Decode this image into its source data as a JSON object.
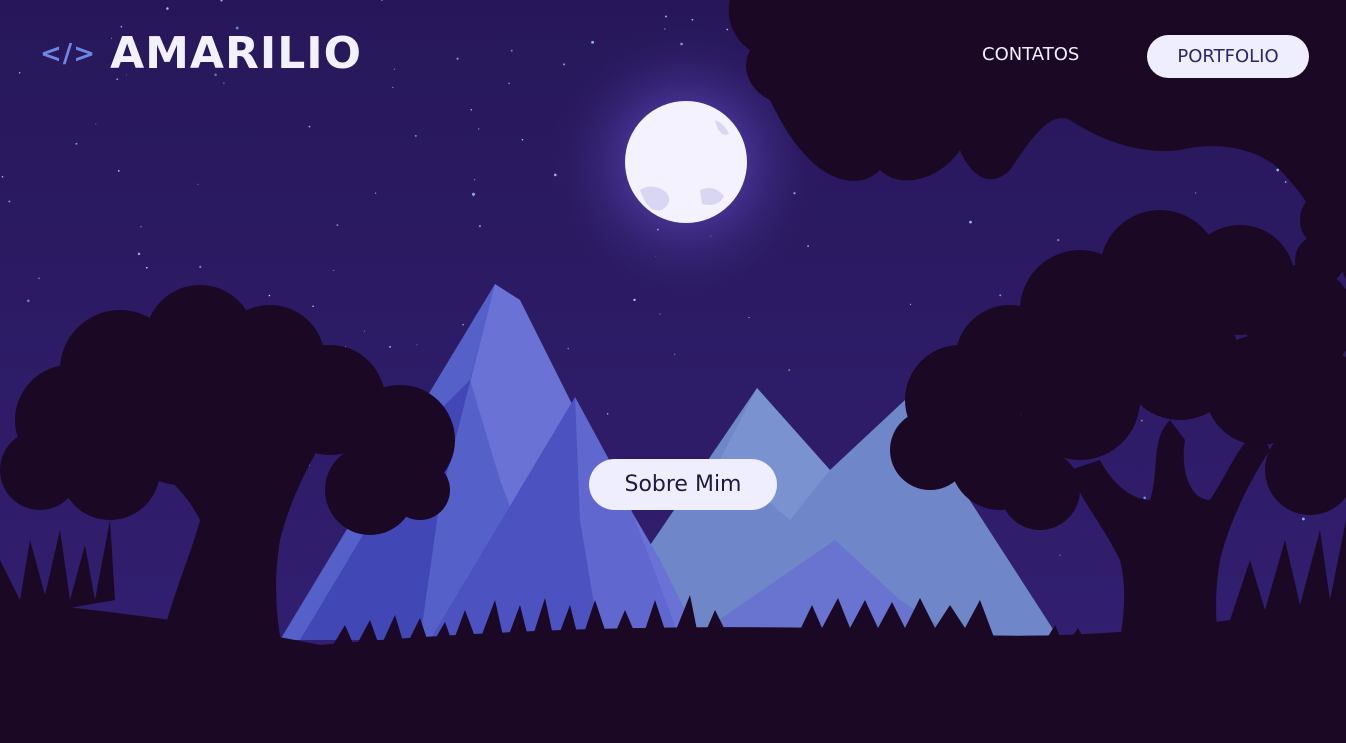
{
  "header": {
    "logo_icon": "</>",
    "logo_text": "AMARILIO",
    "nav_contacts": "CONTATOS",
    "nav_portfolio": "PORTFOLIO"
  },
  "hero": {
    "button_label": "Sobre Mim"
  },
  "colors": {
    "sky": "#2b1a5e",
    "silhouette": "#1b0825",
    "mountain_main": "#4f5bc7",
    "mountain_light": "#6f86c8",
    "moon": "#f4f2ff",
    "button_bg": "#eeeefe",
    "logo_accent": "#6f86e3"
  }
}
